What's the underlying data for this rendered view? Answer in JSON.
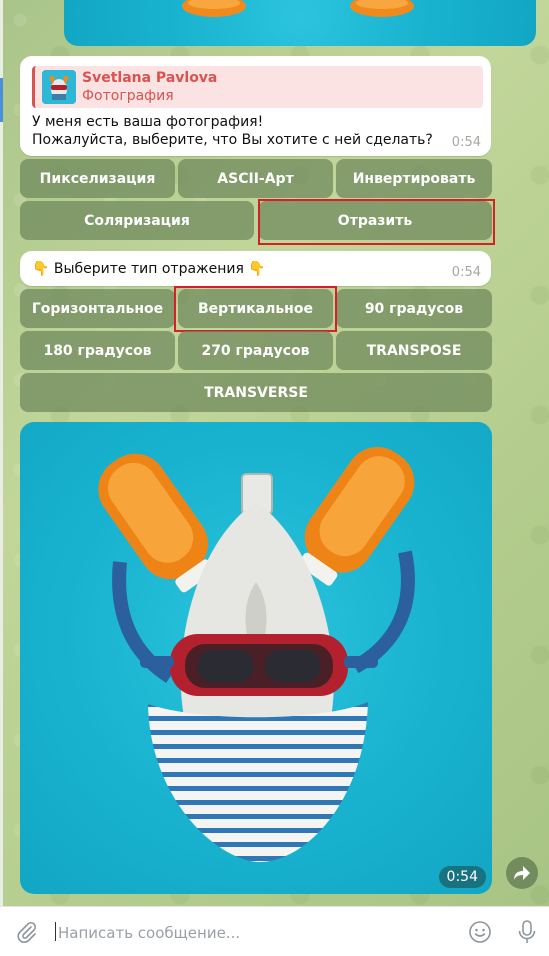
{
  "message1": {
    "reply_name": "Svetlana Pavlova",
    "reply_subtitle": "Фотография",
    "text_line1": "У меня есть ваша фотография!",
    "text_line2": "Пожалуйста, выберите, что Вы хотите с ней сделать?",
    "time": "0:54"
  },
  "keyboard1": {
    "row1": [
      "Пикселизация",
      "ASCII-Арт",
      "Инвертировать"
    ],
    "row2": [
      "Соляризация",
      "Отразить"
    ],
    "highlighted": "Отразить"
  },
  "message2": {
    "emoji_left": "👇",
    "text": "Выберите тип отражения",
    "emoji_right": "👇",
    "time": "0:54"
  },
  "keyboard2": {
    "row1": [
      "Горизонтальное",
      "Вертикальное",
      "90 градусов"
    ],
    "row2": [
      "180 градусов",
      "270 градусов",
      "TRANSPOSE"
    ],
    "row3": [
      "TRANSVERSE"
    ],
    "highlighted": "Вертикальное"
  },
  "photo_message": {
    "time": "0:54"
  },
  "input_bar": {
    "placeholder": "Написать сообщение...",
    "value": "",
    "attach_icon": "paperclip-icon",
    "emoji_icon": "smiley-icon",
    "mic_icon": "microphone-icon"
  },
  "colors": {
    "highlight_border": "#d5202c",
    "reply_accent": "#d9534f",
    "keyboard_button": "#6e875a",
    "photo_background": "#18b2cf"
  }
}
